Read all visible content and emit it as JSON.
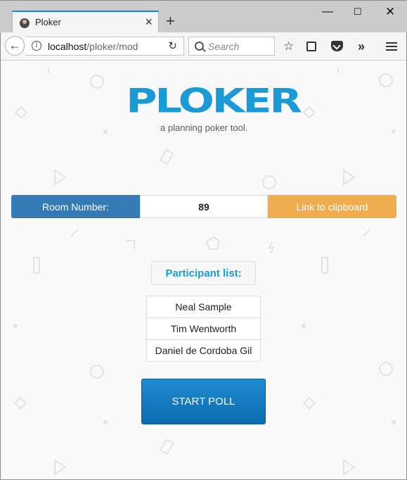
{
  "browser": {
    "tab_title": "Ploker",
    "new_tab": "+",
    "url_host": "localhost",
    "url_path": "/ploker/mod",
    "search_placeholder": "Search"
  },
  "icons": {
    "back": "arrow-left-icon",
    "info": "info-icon",
    "reload": "reload-icon",
    "search": "search-icon",
    "bookmark": "star-icon",
    "reader": "library-icon",
    "pocket": "pocket-icon",
    "overflow": "chevron-double-right-icon",
    "menu": "hamburger-menu-icon"
  },
  "logo": {
    "text": "PLOKER",
    "tagline": "a planning poker tool."
  },
  "room": {
    "label": "Room Number:",
    "number": "89",
    "clipboard_button": "Link to clipboard"
  },
  "participants": {
    "header": "Participant list:",
    "items": [
      "Neal Sample",
      "Tim Wentworth",
      "Daniel de Cordoba Gil"
    ]
  },
  "actions": {
    "start_poll": "START POLL"
  },
  "colors": {
    "brand_blue": "#1a9bd7",
    "room_label_bg": "#337ab7",
    "clipboard_bg": "#f0ad4e",
    "start_button_bg": "#0b6bb0"
  }
}
